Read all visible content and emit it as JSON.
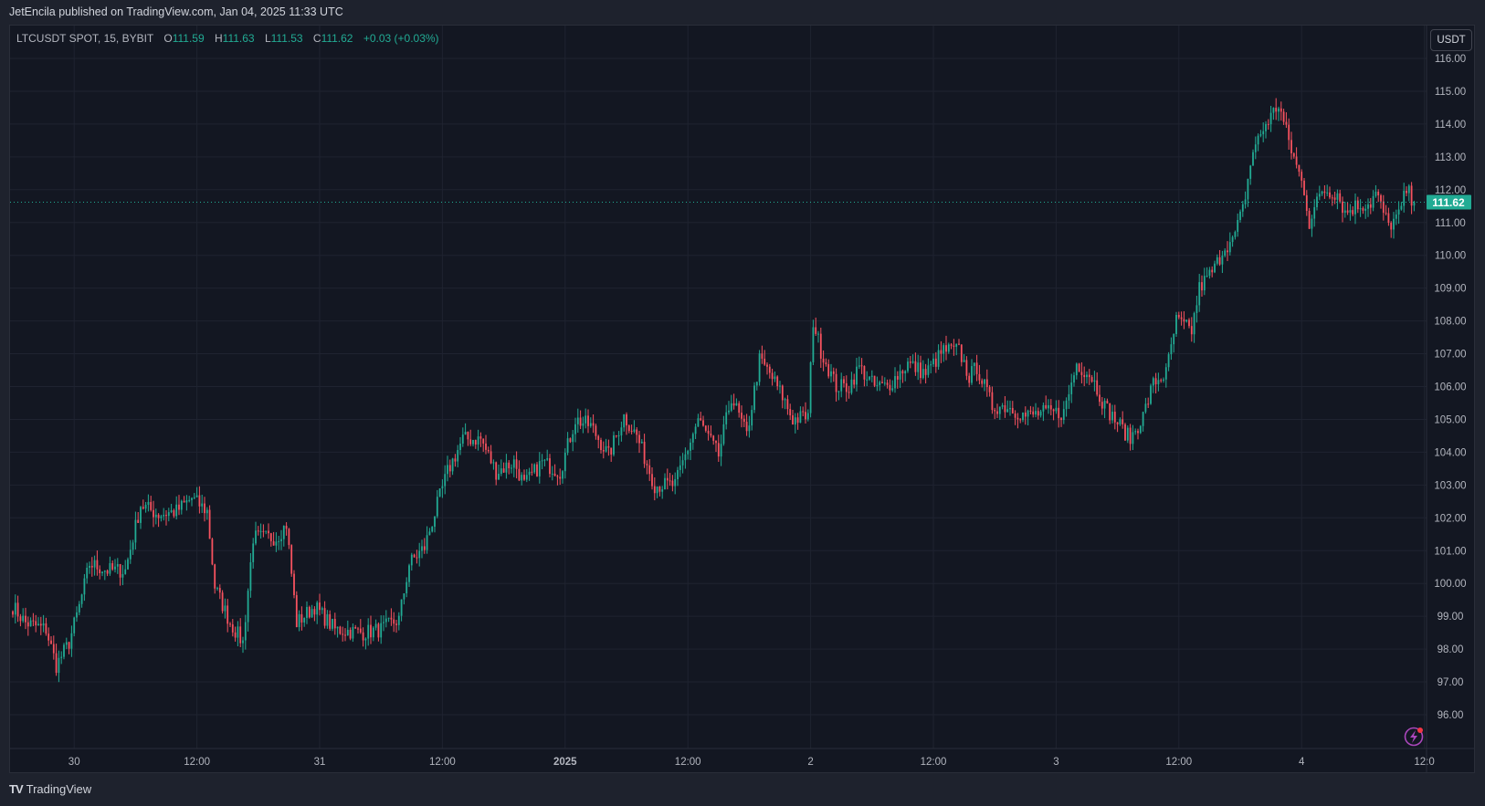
{
  "header": {
    "published": "JetEncila published on TradingView.com, Jan 04, 2025 11:33 UTC"
  },
  "legend": {
    "symbol": "LTCUSDT SPOT, 15, BYBIT",
    "o_label": "O",
    "o": "111.59",
    "h_label": "H",
    "h": "111.63",
    "l_label": "L",
    "l": "111.53",
    "c_label": "C",
    "c": "111.62",
    "change": "+0.03 (+0.03%)"
  },
  "price_axis": {
    "currency": "USDT",
    "ticks": [
      "116.00",
      "115.00",
      "114.00",
      "113.00",
      "112.00",
      "111.00",
      "110.00",
      "109.00",
      "108.00",
      "107.00",
      "106.00",
      "105.00",
      "104.00",
      "103.00",
      "102.00",
      "101.00",
      "100.00",
      "99.00",
      "98.00",
      "97.00",
      "96.00"
    ],
    "last_price": "111.62"
  },
  "time_axis": {
    "ticks": [
      {
        "label": "30",
        "bar": 24,
        "bold": false
      },
      {
        "label": "12:00",
        "bar": 72,
        "bold": false
      },
      {
        "label": "31",
        "bar": 120,
        "bold": false
      },
      {
        "label": "12:00",
        "bar": 168,
        "bold": false
      },
      {
        "label": "2025",
        "bar": 216,
        "bold": true
      },
      {
        "label": "12:00",
        "bar": 264,
        "bold": false
      },
      {
        "label": "2",
        "bar": 312,
        "bold": false
      },
      {
        "label": "12:00",
        "bar": 360,
        "bold": false
      },
      {
        "label": "3",
        "bar": 408,
        "bold": false
      },
      {
        "label": "12:00",
        "bar": 456,
        "bold": false
      },
      {
        "label": "4",
        "bar": 504,
        "bold": false
      },
      {
        "label": "12:0",
        "bar": 552,
        "bold": false
      }
    ]
  },
  "footer": {
    "brand": "TradingView"
  },
  "colors": {
    "up": "#22ab94",
    "down": "#f7525f",
    "bg": "#131722",
    "grid": "#1f2330",
    "accent": "#22ab94"
  },
  "chart_data": {
    "type": "candlestick",
    "symbol": "LTCUSDT",
    "interval": "15",
    "ylim": [
      95.5,
      116.5
    ],
    "note": "close-price waypoints [bar_index, price]; intermediate candles interpolated",
    "waypoints": [
      [
        0,
        99.3
      ],
      [
        5,
        98.8
      ],
      [
        13,
        98.6
      ],
      [
        17,
        97.5
      ],
      [
        22,
        98.2
      ],
      [
        26,
        99.3
      ],
      [
        30,
        100.6
      ],
      [
        37,
        100.4
      ],
      [
        44,
        100.4
      ],
      [
        50,
        102.4
      ],
      [
        57,
        102.1
      ],
      [
        64,
        102.2
      ],
      [
        70,
        102.6
      ],
      [
        76,
        102.2
      ],
      [
        79,
        99.9
      ],
      [
        85,
        98.8
      ],
      [
        90,
        98.2
      ],
      [
        94,
        101.4
      ],
      [
        103,
        101.4
      ],
      [
        107,
        101.8
      ],
      [
        111,
        98.8
      ],
      [
        118,
        99.3
      ],
      [
        126,
        98.6
      ],
      [
        137,
        98.5
      ],
      [
        144,
        98.6
      ],
      [
        151,
        98.9
      ],
      [
        155,
        100.6
      ],
      [
        161,
        101.1
      ],
      [
        166,
        102.4
      ],
      [
        170,
        103.4
      ],
      [
        176,
        104.4
      ],
      [
        183,
        104.4
      ],
      [
        189,
        103.4
      ],
      [
        196,
        103.7
      ],
      [
        200,
        103.0
      ],
      [
        207,
        103.7
      ],
      [
        214,
        103.4
      ],
      [
        220,
        105.0
      ],
      [
        226,
        104.8
      ],
      [
        233,
        103.9
      ],
      [
        239,
        105.1
      ],
      [
        244,
        104.5
      ],
      [
        251,
        103.0
      ],
      [
        259,
        103.0
      ],
      [
        263,
        103.9
      ],
      [
        268,
        105.0
      ],
      [
        276,
        103.9
      ],
      [
        281,
        105.7
      ],
      [
        287,
        104.5
      ],
      [
        292,
        106.8
      ],
      [
        296,
        106.4
      ],
      [
        301,
        105.7
      ],
      [
        305,
        105.0
      ],
      [
        311,
        105.1
      ],
      [
        313,
        108.0
      ],
      [
        316,
        107.1
      ],
      [
        322,
        106.0
      ],
      [
        327,
        106.0
      ],
      [
        331,
        106.6
      ],
      [
        337,
        106.0
      ],
      [
        342,
        106.0
      ],
      [
        350,
        106.7
      ],
      [
        357,
        106.4
      ],
      [
        364,
        107.1
      ],
      [
        370,
        107.1
      ],
      [
        374,
        106.3
      ],
      [
        377,
        106.6
      ],
      [
        383,
        105.4
      ],
      [
        389,
        105.4
      ],
      [
        396,
        105.1
      ],
      [
        403,
        105.2
      ],
      [
        411,
        105.2
      ],
      [
        416,
        106.7
      ],
      [
        422,
        106.3
      ],
      [
        427,
        105.4
      ],
      [
        433,
        104.8
      ],
      [
        437,
        104.4
      ],
      [
        442,
        105.1
      ],
      [
        446,
        106.1
      ],
      [
        451,
        106.4
      ],
      [
        455,
        108.0
      ],
      [
        461,
        107.7
      ],
      [
        464,
        109.0
      ],
      [
        470,
        109.6
      ],
      [
        474,
        110.3
      ],
      [
        477,
        110.4
      ],
      [
        481,
        111.4
      ],
      [
        485,
        113.2
      ],
      [
        490,
        114.0
      ],
      [
        495,
        114.6
      ],
      [
        500,
        113.2
      ],
      [
        505,
        112.0
      ],
      [
        507,
        111.0
      ],
      [
        512,
        112.0
      ],
      [
        518,
        111.9
      ],
      [
        521,
        111.3
      ],
      [
        525,
        111.5
      ],
      [
        531,
        111.6
      ],
      [
        533,
        111.9
      ],
      [
        538,
        110.9
      ],
      [
        542,
        111.2
      ],
      [
        545,
        112.0
      ],
      [
        548,
        111.62
      ]
    ]
  }
}
